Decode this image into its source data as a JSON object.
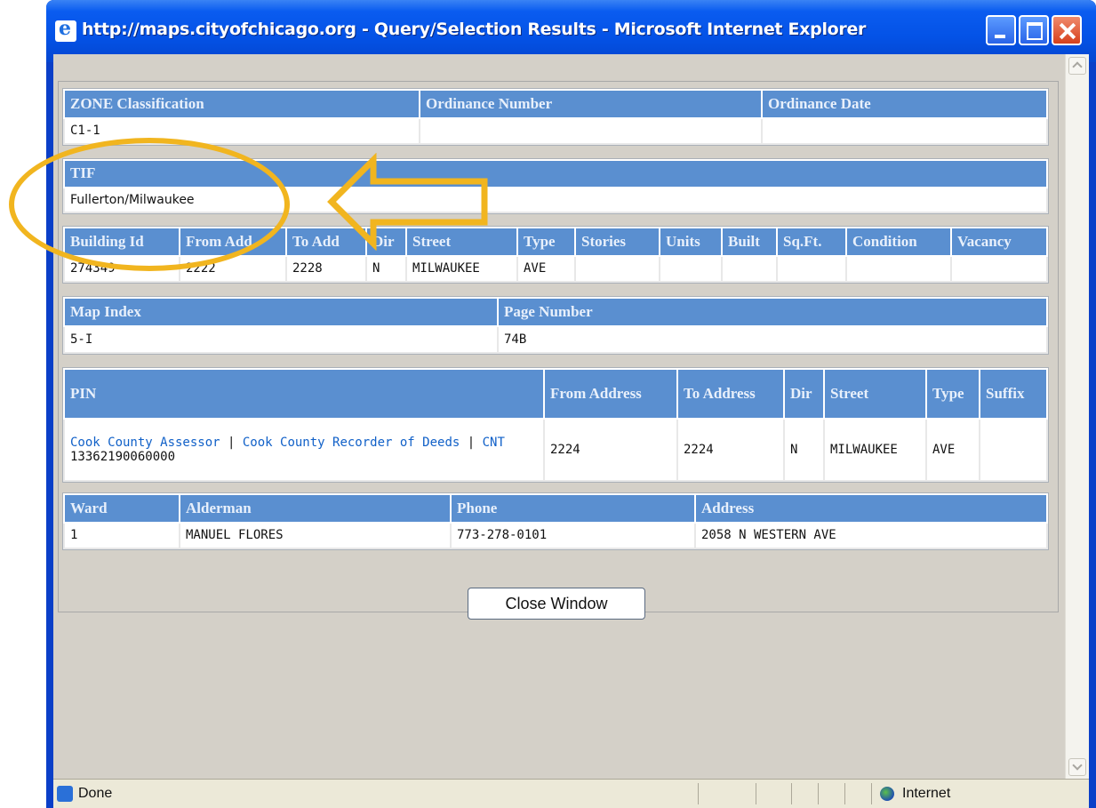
{
  "window": {
    "title": "http://maps.cityofchicago.org - Query/Selection Results - Microsoft Internet Explorer"
  },
  "zone": {
    "headers": [
      "ZONE Classification",
      "Ordinance Number",
      "Ordinance Date"
    ],
    "values": [
      "C1-1",
      "",
      ""
    ]
  },
  "tif": {
    "header": "TIF",
    "value": "Fullerton/Milwaukee"
  },
  "building": {
    "headers": [
      "Building Id",
      "From Add",
      "To Add",
      "Dir",
      "Street",
      "Type",
      "Stories",
      "Units",
      "Built",
      "Sq.Ft.",
      "Condition",
      "Vacancy"
    ],
    "values": [
      "274349",
      "2222",
      "2228",
      "N",
      "MILWAUKEE",
      "AVE",
      "",
      "",
      "",
      "",
      "",
      ""
    ]
  },
  "map": {
    "headers": [
      "Map Index",
      "Page Number"
    ],
    "values": [
      "5-I",
      "74B"
    ]
  },
  "pin": {
    "headers": [
      "PIN",
      "From Address",
      "To Address",
      "Dir",
      "Street",
      "Type",
      "Suffix"
    ],
    "links": {
      "assessor": "Cook County Assessor",
      "sep1": " | ",
      "recorder": "Cook County Recorder of Deeds",
      "sep2": " | ",
      "cnt": "CNT"
    },
    "pin_number": "13362190060000",
    "values": [
      "2224",
      "2224",
      "N",
      "MILWAUKEE",
      "AVE",
      ""
    ]
  },
  "ward": {
    "headers": [
      "Ward",
      "Alderman",
      "Phone",
      "Address"
    ],
    "values": [
      "1",
      "MANUEL FLORES",
      "773-278-0101",
      "2058 N WESTERN AVE"
    ]
  },
  "close_button": "Close Window",
  "status": {
    "text": "Done",
    "zone": "Internet"
  },
  "colors": {
    "header_bg": "#5a8fd0",
    "annotation": "#f1b51f",
    "titlebar": "#0452e6"
  }
}
